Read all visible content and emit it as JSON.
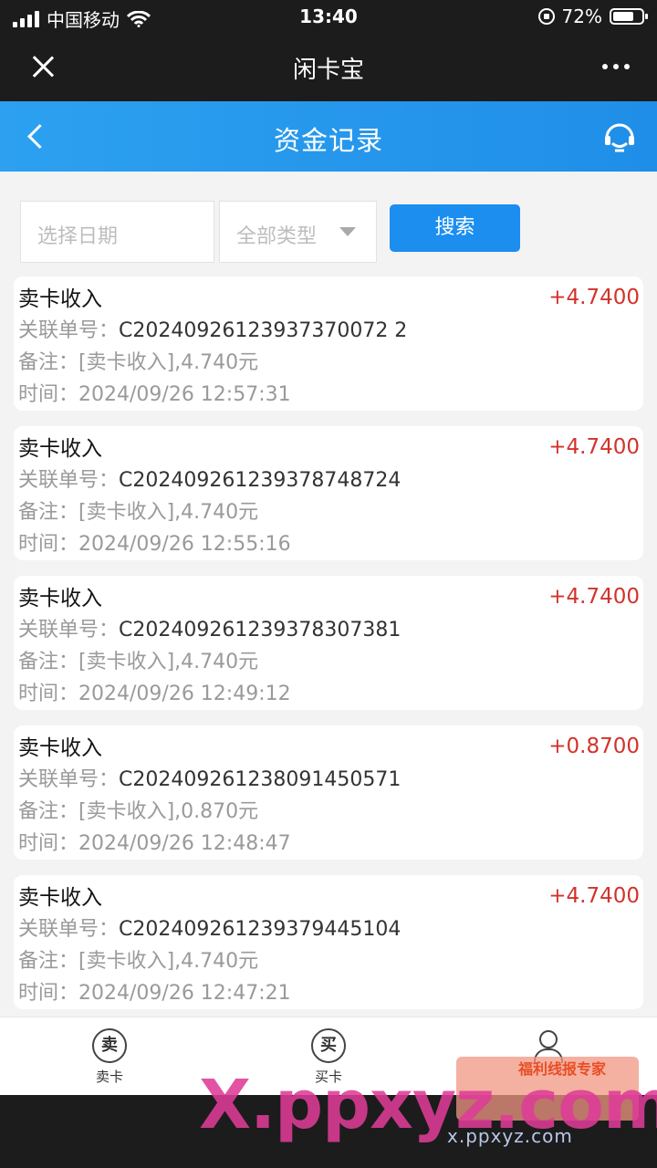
{
  "status_bar": {
    "carrier": "中国移动",
    "time": "13:40",
    "battery": "72%",
    "battery_level": 0.72
  },
  "wechat_bar": {
    "title": "闲卡宝",
    "close_icon": "close-icon",
    "more_icon": "more-dots-icon"
  },
  "header": {
    "title": "资金记录",
    "back_icon": "chevron-left-icon",
    "service_icon": "customer-service-icon"
  },
  "filters": {
    "date_placeholder": "选择日期",
    "type_value": "全部类型",
    "search_label": "搜索"
  },
  "labels": {
    "order": "关联单号：",
    "remark": "备注：",
    "time": "时间："
  },
  "records": [
    {
      "type": "卖卡收入",
      "amount": "+4.7400",
      "order": "C20240926123937370072 2",
      "remark": "[卖卡收入],4.740元",
      "time": "2024/09/26 12:57:31"
    },
    {
      "type": "卖卡收入",
      "amount": "+4.7400",
      "order": "C202409261239378748724",
      "remark": "[卖卡收入],4.740元",
      "time": "2024/09/26 12:55:16"
    },
    {
      "type": "卖卡收入",
      "amount": "+4.7400",
      "order": "C202409261239378307381",
      "remark": "[卖卡收入],4.740元",
      "time": "2024/09/26 12:49:12"
    },
    {
      "type": "卖卡收入",
      "amount": "+0.8700",
      "order": "C202409261238091450571",
      "remark": "[卖卡收入],0.870元",
      "time": "2024/09/26 12:48:47"
    },
    {
      "type": "卖卡收入",
      "amount": "+4.7400",
      "order": "C202409261239379445104",
      "remark": "[卖卡收入],4.740元",
      "time": "2024/09/26 12:47:21"
    }
  ],
  "tabbar": {
    "sell_icon_char": "卖",
    "sell_label": "卖卡",
    "buy_icon_char": "买",
    "buy_label": "买卡"
  },
  "watermark": {
    "main": "X.ppxyz.com",
    "url": "x.ppxyz.com",
    "badge": "福利线报专家"
  },
  "colors": {
    "header_blue": "#1f8ee8",
    "amount_red": "#d2332b",
    "search_button": "#1b8ef0"
  }
}
